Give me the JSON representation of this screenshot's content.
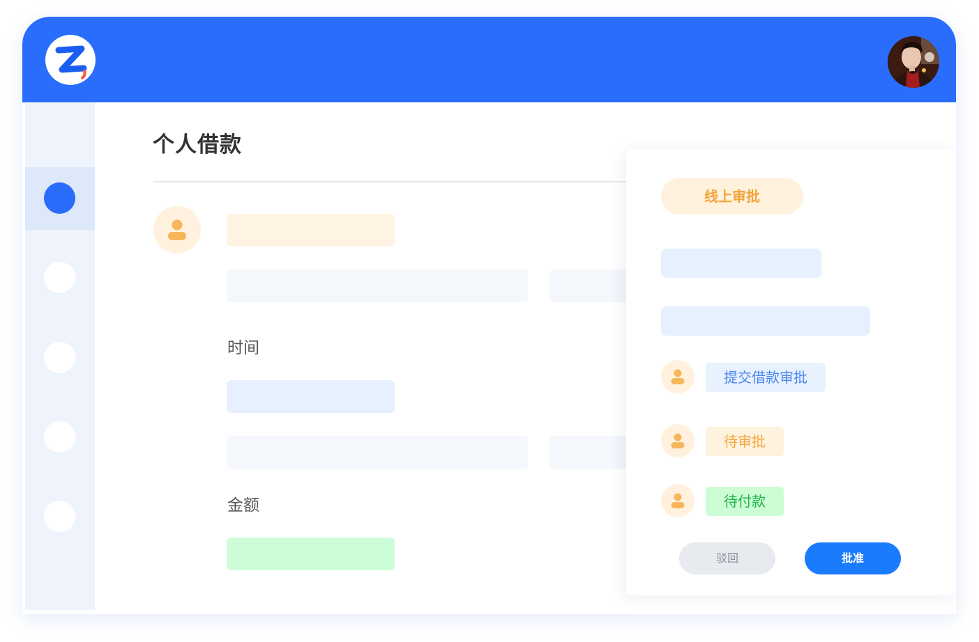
{
  "page": {
    "title": "个人借款"
  },
  "form": {
    "time_label": "时间",
    "amount_label": "金额"
  },
  "approval_panel": {
    "status_pill": "线上审批",
    "steps": [
      {
        "label": "提交借款审批",
        "color": "#4a86f0"
      },
      {
        "label": "待审批",
        "color": "#f4a63c"
      },
      {
        "label": "待付款",
        "color": "#22b34a"
      }
    ],
    "reject_label": "驳回",
    "approve_label": "批准"
  },
  "sidebar": {
    "items_count": 5,
    "active_index": 0
  },
  "colors": {
    "brand": "#2a6dfd",
    "accent_orange": "#f3a43a",
    "accent_green": "#22b34a",
    "button_primary": "#1a7bfd"
  },
  "icons": {
    "logo": "z-logo-icon",
    "user": "user-icon",
    "avatar": "user-avatar"
  }
}
